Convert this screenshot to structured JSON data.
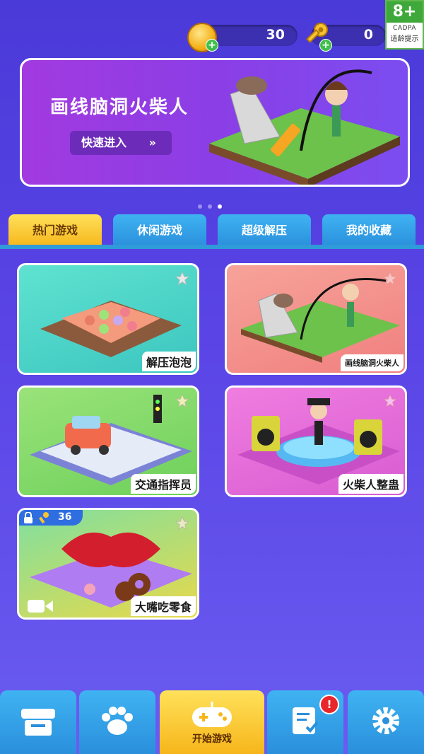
{
  "resources": {
    "coins": "30",
    "keys": "0"
  },
  "age_rating": {
    "rating": "8+",
    "org": "CADPA",
    "hint": "适龄提示"
  },
  "banner": {
    "title": "画线脑洞火柴人",
    "button": "快速进入",
    "pages": 3,
    "current_page": 3
  },
  "tabs": [
    {
      "label": "热门游戏",
      "active": true
    },
    {
      "label": "休闲游戏",
      "active": false
    },
    {
      "label": "超级解压",
      "active": false
    },
    {
      "label": "我的收藏",
      "active": false
    }
  ],
  "games": [
    {
      "title": "解压泡泡",
      "bg": "#4fd6c4"
    },
    {
      "title": "画线脑洞火柴人",
      "bg": "#f48c8a"
    },
    {
      "title": "交通指挥员",
      "bg": "#7fd66a"
    },
    {
      "title": "火柴人整蛊",
      "bg": "#e76fd9"
    },
    {
      "title": "大嘴吃零食",
      "bg": "#5fd08a",
      "locked": true,
      "unlock_keys": "36"
    }
  ],
  "nav": [
    {
      "icon": "shop-icon"
    },
    {
      "icon": "paw-icon"
    },
    {
      "icon": "gamepad-icon",
      "label": "开始游戏"
    },
    {
      "icon": "tasks-icon",
      "badge": "!"
    },
    {
      "icon": "settings-icon"
    }
  ]
}
